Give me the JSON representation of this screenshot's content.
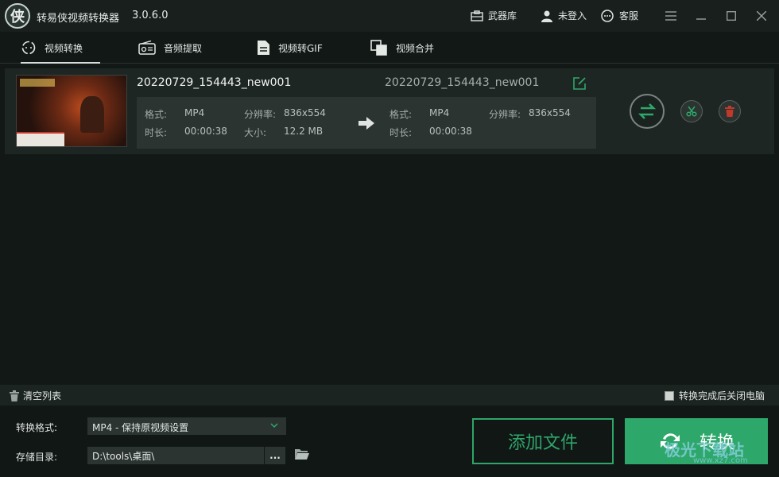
{
  "app": {
    "title": "转易侠视频转换器",
    "version": "3.0.6.0",
    "logo_letter": "侠"
  },
  "titlebar": {
    "arsenal": "武器库",
    "login": "未登入",
    "service": "客服"
  },
  "tabs": [
    {
      "label": "视频转换",
      "icon": "video-convert-icon",
      "active": true
    },
    {
      "label": "音频提取",
      "icon": "audio-extract-icon",
      "active": false
    },
    {
      "label": "视频转GIF",
      "icon": "gif-icon",
      "active": false
    },
    {
      "label": "视频合并",
      "icon": "merge-icon",
      "active": false
    }
  ],
  "file": {
    "src_name": "20220729_154443_new001",
    "dst_name": "20220729_154443_new001",
    "src": {
      "format_label": "格式:",
      "format": "MP4",
      "resolution_label": "分辨率:",
      "resolution": "836x554",
      "duration_label": "时长:",
      "duration": "00:00:38",
      "size_label": "大小:",
      "size": "12.2 MB"
    },
    "dst": {
      "format_label": "格式:",
      "format": "MP4",
      "resolution_label": "分辨率:",
      "resolution": "836x554",
      "duration_label": "时长:",
      "duration": "00:00:38"
    }
  },
  "clearbar": {
    "clear": "清空列表",
    "shutdown": "转换完成后关闭电脑"
  },
  "bottom": {
    "format_label": "转换格式:",
    "format_value": "MP4 - 保持原视频设置",
    "dir_label": "存储目录:",
    "dir_value": "D:\\tools\\桌面\\",
    "dots": "...",
    "add_files": "添加文件",
    "convert": "转换"
  },
  "watermark": {
    "text": "极光下载站",
    "url": "www.xz7.com"
  },
  "colors": {
    "accent": "#2ea76a",
    "bg": "#121816",
    "panel": "#1e2623",
    "delete": "#c0392b"
  }
}
